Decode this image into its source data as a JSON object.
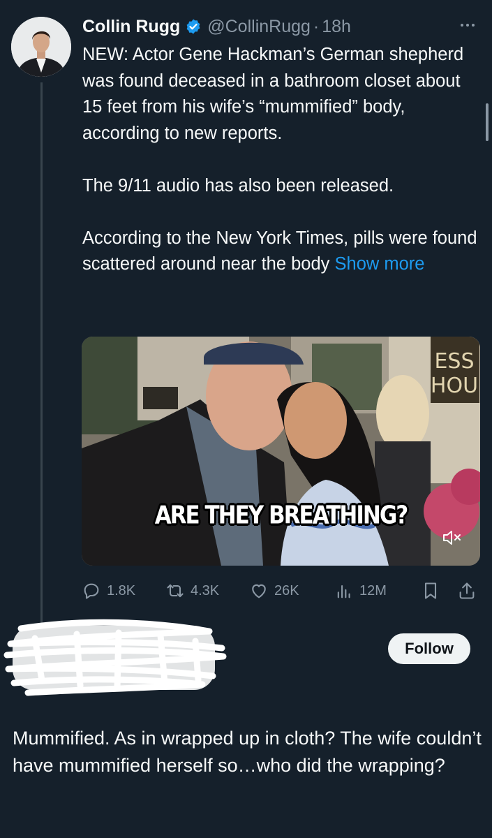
{
  "tweet": {
    "author_name": "Collin Rugg",
    "handle": "@CollinRugg",
    "separator": "·",
    "time": "18h",
    "paragraphs": [
      "NEW: Actor Gene Hackman’s German shepherd was found deceased in a bathroom closet about 15 feet from his wife’s “mummified” body, according to new reports.",
      "The 9/11 audio has also been released.",
      "According to the New York Times, pills were found scattered around near the body"
    ],
    "show_more": "Show more",
    "media": {
      "caption": "ARE THEY BREATHING?",
      "sign_text": "ESS HOU"
    },
    "stats": {
      "replies": "1.8K",
      "reposts": "4.3K",
      "likes": "26K",
      "views": "12M"
    },
    "icons": [
      "more-icon",
      "verified-badge-icon",
      "reply-icon",
      "repost-icon",
      "like-icon",
      "views-icon",
      "bookmark-icon",
      "share-icon",
      "mute-icon"
    ]
  },
  "reply": {
    "follow_label": "Follow",
    "text": "Mummified. As in wrapped up in cloth? The wife couldn’t have mummified herself so…who did the wrapping?"
  },
  "colors": {
    "background": "#15202b",
    "text": "#f7f9f9",
    "secondary": "#8b98a5",
    "accent": "#1d9bf0"
  }
}
